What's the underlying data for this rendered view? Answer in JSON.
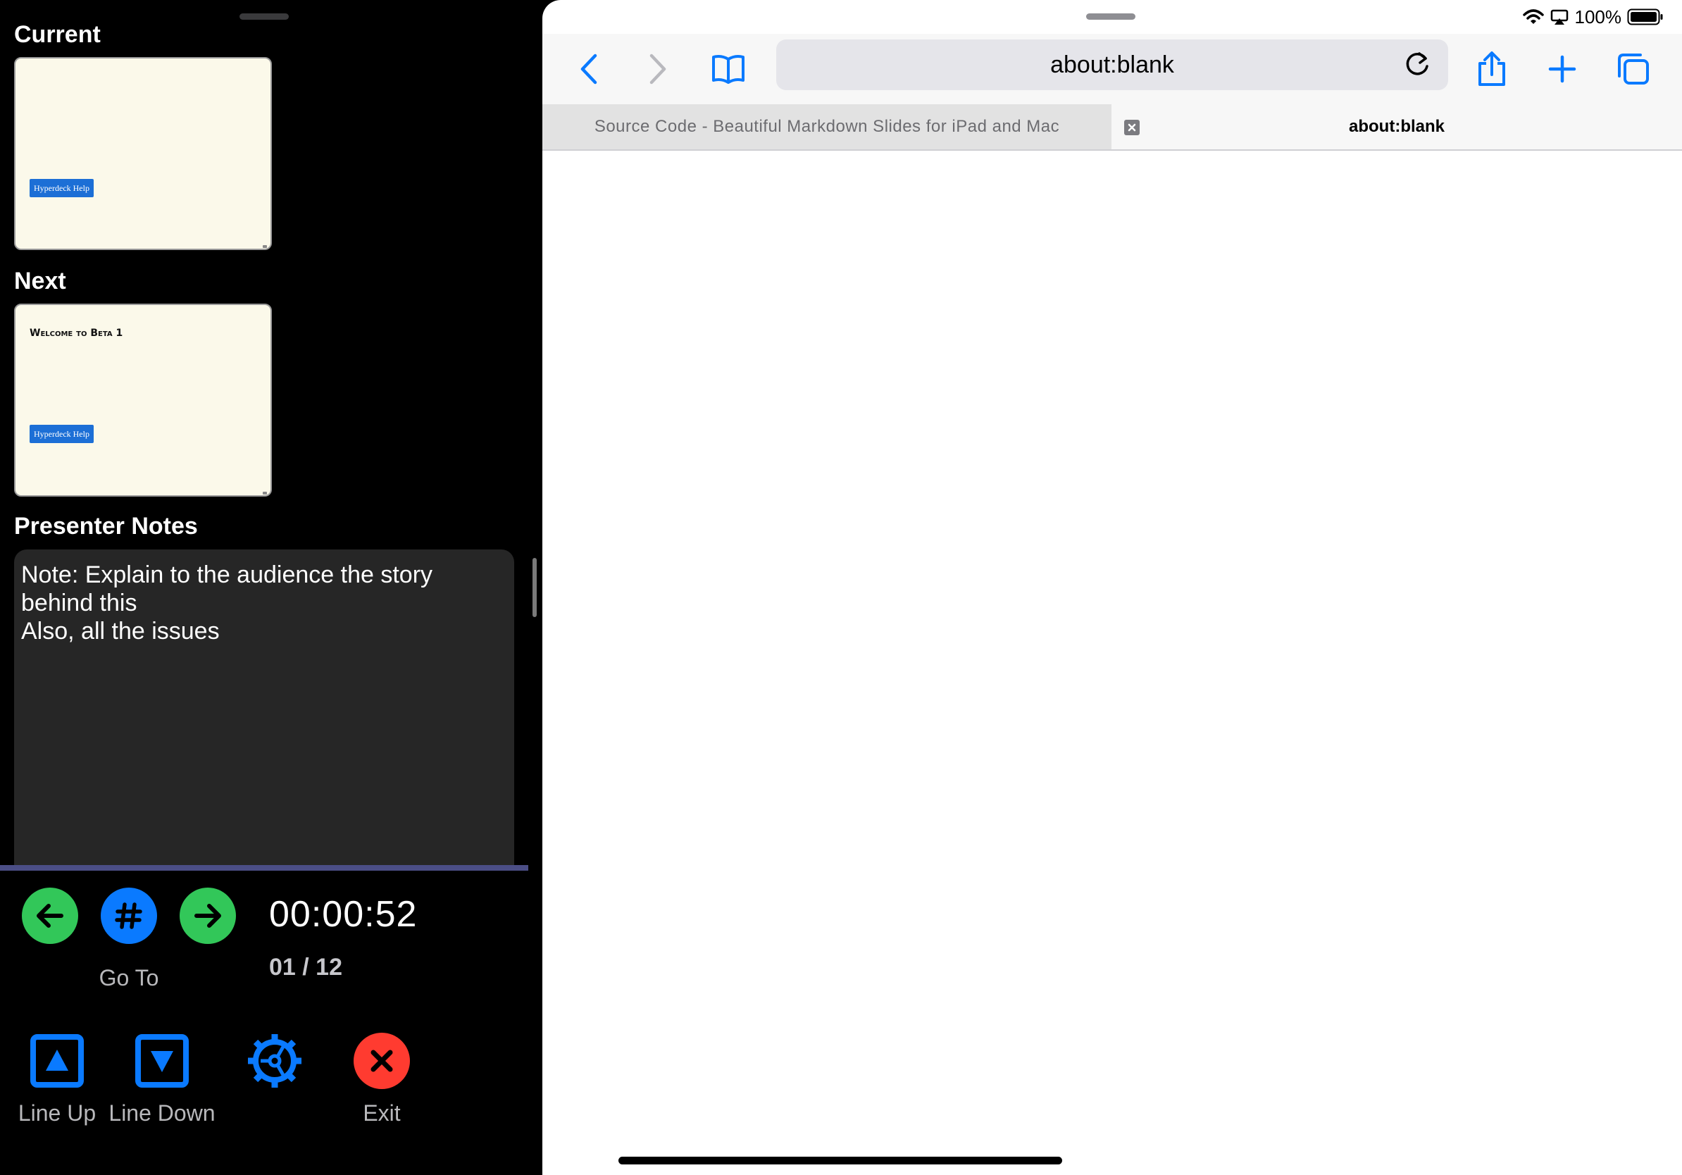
{
  "presenter": {
    "current_label": "Current",
    "next_label": "Next",
    "notes_label": "Presenter Notes",
    "current_slide": {
      "button_text": "Hyperdeck Help"
    },
    "next_slide": {
      "title": "Welcome to Beta 1",
      "button_text": "Hyperdeck Help"
    },
    "notes_text": "Note: Explain to the audience the story\nbehind this\nAlso, all the issues",
    "controls": {
      "goto_label": "Go To",
      "timer": "00:00:52",
      "slide_counter": "01 / 12",
      "line_up_label": "Line Up",
      "line_down_label": "Line Down",
      "exit_label": "Exit"
    },
    "colors": {
      "green": "#32c759",
      "blue": "#0a7aff",
      "red": "#ff3b30",
      "progress": "#4b4e86"
    }
  },
  "status_bar": {
    "battery_text": "100%",
    "icons": [
      "wifi-icon",
      "airplay-icon",
      "battery-icon"
    ]
  },
  "browser": {
    "address": "about:blank",
    "tabs": [
      {
        "label": "Source Code - Beautiful Markdown Slides for iPad and Mac",
        "active": false
      },
      {
        "label": "about:blank",
        "active": true
      }
    ],
    "toolbar_icons": [
      "back-icon",
      "forward-icon",
      "bookmarks-icon",
      "reload-icon",
      "share-icon",
      "new-tab-icon",
      "tabs-overview-icon"
    ],
    "accent": "#0a7aff"
  }
}
